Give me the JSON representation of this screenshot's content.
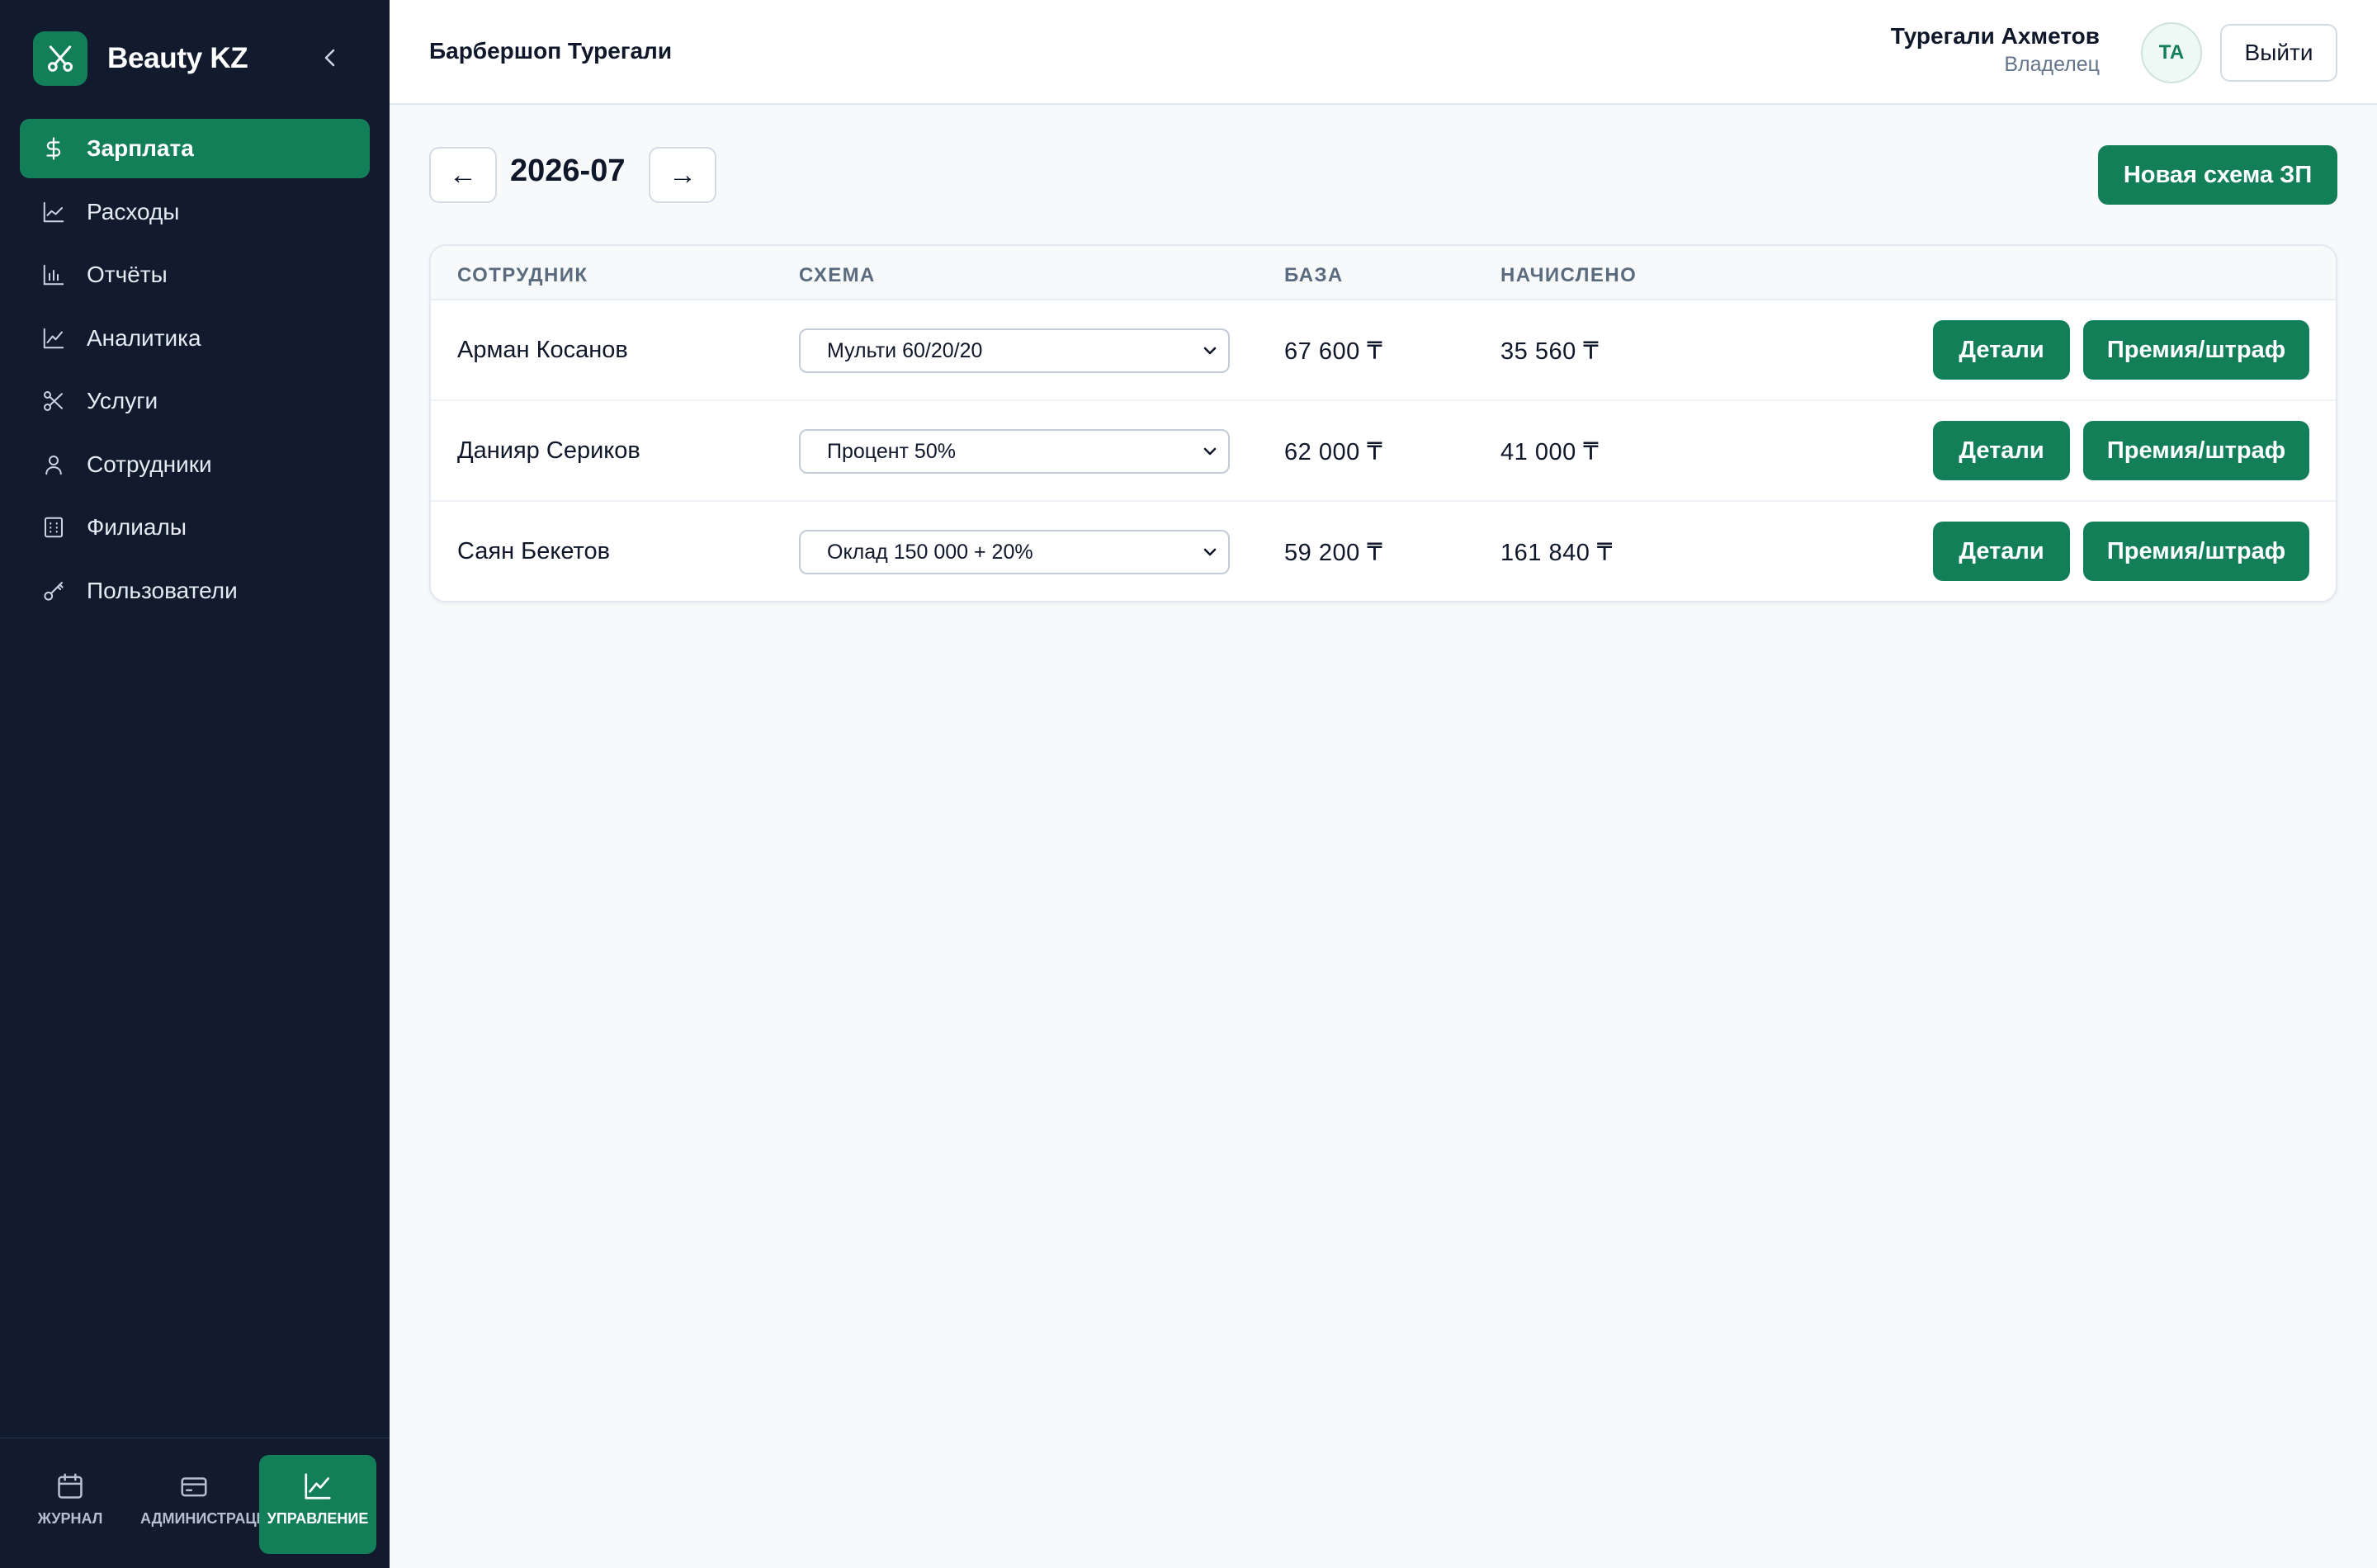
{
  "brand": {
    "name": "Beauty KZ",
    "logo_icon": "scissors-icon"
  },
  "sidebar": {
    "items": [
      {
        "label": "Зарплата",
        "icon": "dollar-icon",
        "active": true
      },
      {
        "label": "Расходы",
        "icon": "area-chart-icon",
        "active": false
      },
      {
        "label": "Отчёты",
        "icon": "bar-chart-icon",
        "active": false
      },
      {
        "label": "Аналитика",
        "icon": "line-chart-icon",
        "active": false
      },
      {
        "label": "Услуги",
        "icon": "scissors-icon",
        "active": false
      },
      {
        "label": "Сотрудники",
        "icon": "user-icon",
        "active": false
      },
      {
        "label": "Филиалы",
        "icon": "building-icon",
        "active": false
      },
      {
        "label": "Пользователи",
        "icon": "key-icon",
        "active": false
      }
    ]
  },
  "bottom_nav": {
    "items": [
      {
        "label": "ЖУРНАЛ",
        "icon": "calendar-icon",
        "active": false
      },
      {
        "label": "АДМИНИСТРАЦИЯ",
        "icon": "card-icon",
        "active": false
      },
      {
        "label": "УПРАВЛЕНИЕ",
        "icon": "chart-icon",
        "active": true
      }
    ]
  },
  "header": {
    "org_title": "Барбершоп Турегали",
    "user_name": "Турегали Ахметов",
    "user_role": "Владелец",
    "avatar_initials": "ТА",
    "logout_label": "Выйти"
  },
  "toolbar": {
    "prev_label": "←",
    "period": "2026-07",
    "next_label": "→",
    "new_scheme_label": "Новая схема ЗП"
  },
  "table": {
    "columns": [
      "СОТРУДНИК",
      "СХЕМА",
      "БАЗА",
      "НАЧИСЛЕНО"
    ],
    "rows": [
      {
        "employee": "Арман Косанов",
        "scheme": "Мульти 60/20/20",
        "base": "67 600 ₸",
        "accrued": "35 560 ₸",
        "details_label": "Детали",
        "bonus_label": "Премия/штраф"
      },
      {
        "employee": "Данияр Сериков",
        "scheme": "Процент 50%",
        "base": "62 000 ₸",
        "accrued": "41 000 ₸",
        "details_label": "Детали",
        "bonus_label": "Премия/штраф"
      },
      {
        "employee": "Саян Бекетов",
        "scheme": "Оклад 150 000 + 20%",
        "base": "59 200 ₸",
        "accrued": "161 840 ₸",
        "details_label": "Детали",
        "bonus_label": "Премия/штраф"
      }
    ]
  },
  "colors": {
    "accent": "#127f59",
    "sidebar_bg": "#121a2e",
    "page_bg": "#f7f9fb"
  }
}
